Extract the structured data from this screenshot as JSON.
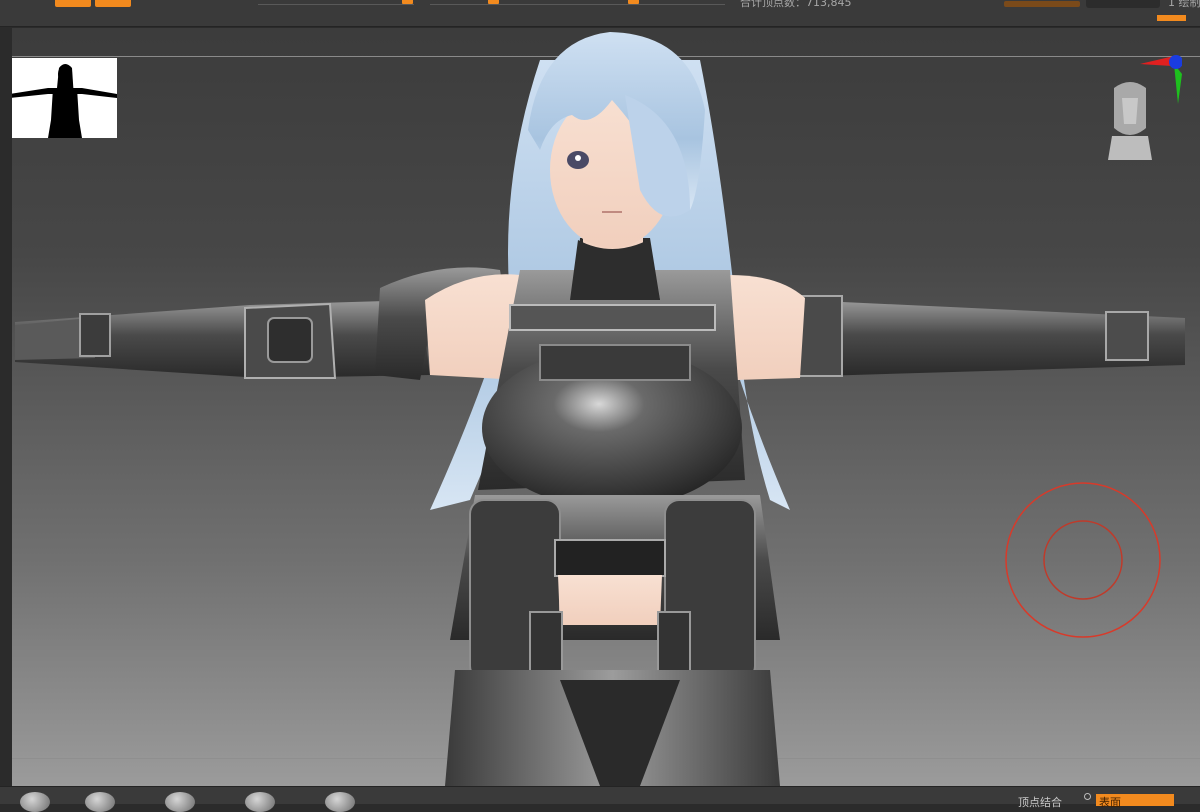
{
  "toolbar": {
    "slider_labels": [
      "",
      "",
      ""
    ],
    "stat_label": "合计顶点数：713,845",
    "right_label": "1 绘制"
  },
  "viewport": {
    "description_hidden": ""
  },
  "bottom_bar": {
    "weld_label": "顶点结合",
    "active_button": "表面"
  },
  "colors": {
    "accent": "#f28a1e",
    "panel": "#3a3a3a",
    "gizmo_x": "#e02020",
    "gizmo_y": "#1ec01e",
    "gizmo_z": "#1a3ce0",
    "brush_ring": "#d83a2a"
  },
  "icons": [
    "navigation-thumbnail-icon",
    "axis-gizmo-icon",
    "head-orientation-icon",
    "brush-cursor-icon",
    "material-ball-icon"
  ]
}
